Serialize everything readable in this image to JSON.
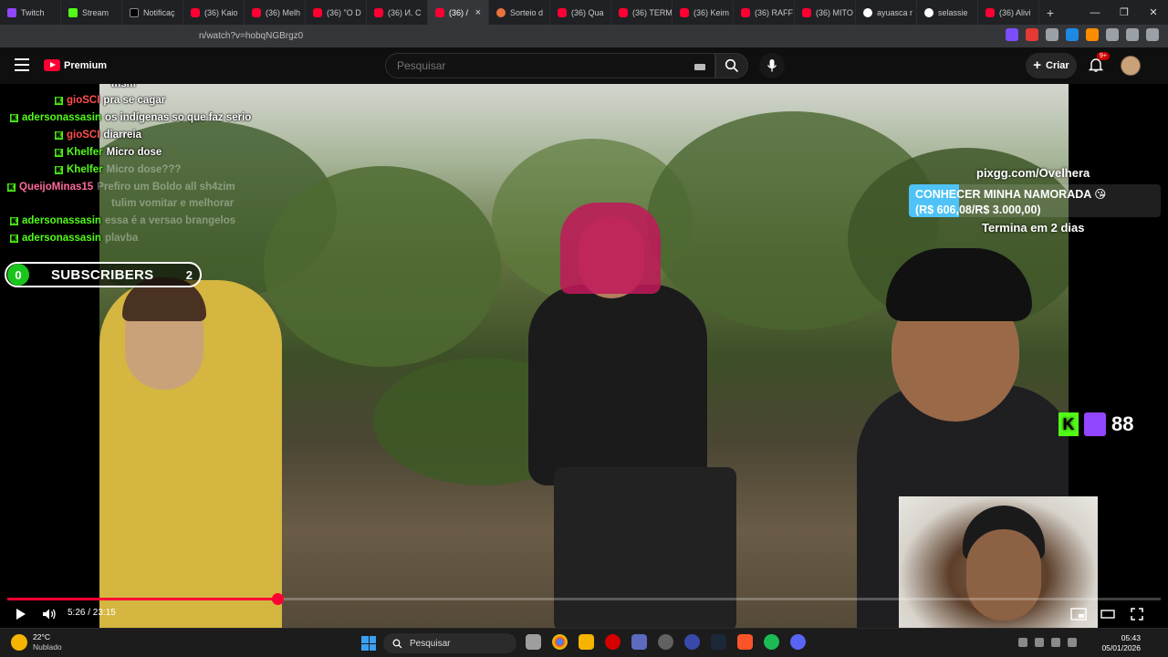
{
  "tabs": [
    {
      "label": "Twitch",
      "icon": "twitch-icon"
    },
    {
      "label": "Stream",
      "icon": "kick-icon"
    },
    {
      "label": "Notificaç",
      "icon": "x-icon"
    },
    {
      "label": "(36) Kaio",
      "icon": "youtube-icon"
    },
    {
      "label": "(36) Melh",
      "icon": "youtube-icon"
    },
    {
      "label": "(36) \"O D",
      "icon": "youtube-icon"
    },
    {
      "label": "(36) И. С",
      "icon": "youtube-icon"
    },
    {
      "label": "(36) /",
      "icon": "youtube-icon",
      "active": true
    },
    {
      "label": "Sorteio d",
      "icon": "sorteio-icon"
    },
    {
      "label": "(36) Qua",
      "icon": "youtube-icon"
    },
    {
      "label": "(36) TERM",
      "icon": "youtube-icon"
    },
    {
      "label": "(36) Keim",
      "icon": "youtube-icon"
    },
    {
      "label": "(36) RAFF",
      "icon": "youtube-icon"
    },
    {
      "label": "(36) MITO",
      "icon": "youtube-icon"
    },
    {
      "label": "ayuasca r",
      "icon": "google-icon"
    },
    {
      "label": "selassie",
      "icon": "google-icon"
    },
    {
      "label": "(36) Alivi",
      "icon": "youtube-icon"
    }
  ],
  "address": {
    "url": "n/watch?v=hobqNGBrgz0"
  },
  "youtube": {
    "logo_badge": "Premium",
    "search_placeholder": "Pesquisar",
    "create_label": "Criar",
    "notif_badge": "9+"
  },
  "chat": [
    {
      "user": "",
      "text": "msm",
      "color": "green",
      "dim": false
    },
    {
      "user": "gioSCI",
      "text": "pra se cagar",
      "color": "red",
      "dim": false
    },
    {
      "user": "adersonassasin",
      "text": "os indígenas so que faz serio",
      "color": "green",
      "dim": false
    },
    {
      "user": "gioSCI",
      "text": "diarreia",
      "color": "red",
      "dim": false
    },
    {
      "user": "Khelfer",
      "text": "Micro dose",
      "color": "green",
      "dim": false
    },
    {
      "user": "Khelfer",
      "text": "Micro dose???",
      "color": "green",
      "dim": true
    },
    {
      "user": "QueijoMinas15",
      "text": "Prefiro um Boldo all sh4zim",
      "color": "pink",
      "dim": true
    },
    {
      "user": "",
      "text": "tulim vomitar e melhorar",
      "color": "pink",
      "dim": true
    },
    {
      "user": "adersonassasin",
      "text": "essa é a versao brangelos",
      "color": "green",
      "dim": true
    },
    {
      "user": "adersonassasin",
      "text": "plavba",
      "color": "green",
      "dim": true
    }
  ],
  "subscribers": {
    "count_left": "0",
    "label": "SUBSCRIBERS",
    "count_right": "2"
  },
  "goal": {
    "url": "pixgg.com/Ovelhera",
    "title": "CONHECER MINHA NAMORADA 😘",
    "amount": "(R$ 606,08/R$ 3.000,00)",
    "progress": 0.2,
    "ends": "Termina em 2 dias"
  },
  "viewers": {
    "count": "88"
  },
  "player": {
    "time": "5:26 / 23:15",
    "progress": 0.234
  },
  "taskbar": {
    "weather_temp": "22°C",
    "weather_desc": "Nublado",
    "search_label": "Pesquisar",
    "time": "05:43",
    "date": "05/01/2026"
  },
  "colors": {
    "youtube_red": "#ff0033",
    "kick_green": "#53fc18",
    "twitch_purple": "#9146ff"
  }
}
